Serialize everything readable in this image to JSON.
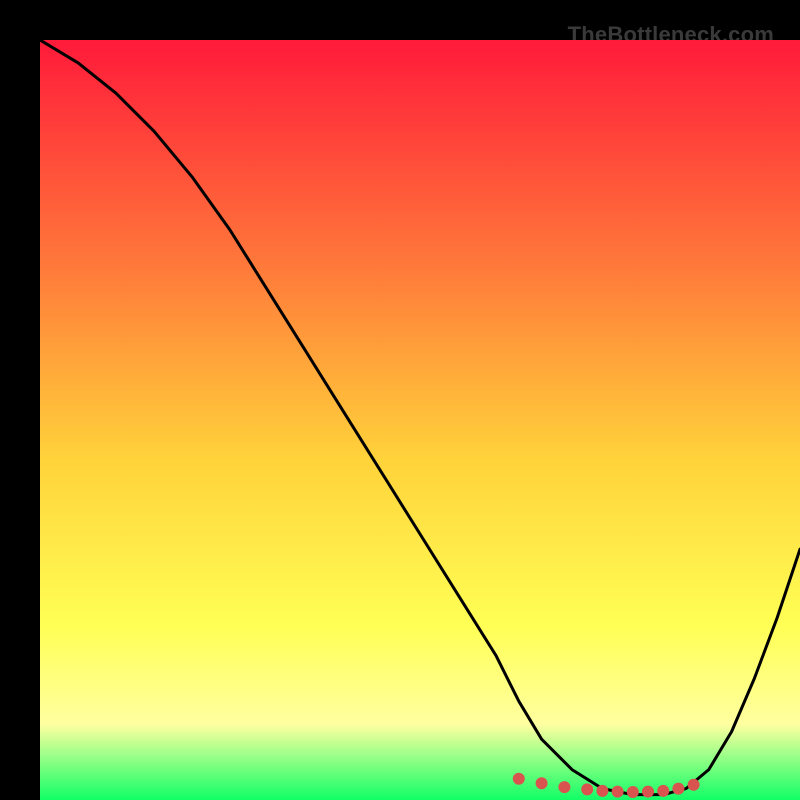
{
  "watermark": "TheBottleneck.com",
  "colors": {
    "bg": "#000000",
    "gradient_top": "#ff1a3a",
    "gradient_mid1": "#ff7a3a",
    "gradient_mid2": "#ffd23a",
    "gradient_mid3": "#ffff55",
    "gradient_mid4": "#ffffa0",
    "gradient_bottom": "#10ff66",
    "curve": "#000000",
    "marker": "#d9544f"
  },
  "chart_data": {
    "type": "line",
    "title": "",
    "xlabel": "",
    "ylabel": "",
    "xlim": [
      0,
      100
    ],
    "ylim": [
      0,
      100
    ],
    "grid": false,
    "legend": false,
    "series": [
      {
        "name": "bottleneck-curve",
        "x": [
          0,
          5,
          10,
          15,
          20,
          25,
          30,
          35,
          40,
          45,
          50,
          55,
          60,
          63,
          66,
          70,
          74,
          78,
          82,
          85,
          88,
          91,
          94,
          97,
          100
        ],
        "y": [
          100,
          97,
          93,
          88,
          82,
          75,
          67,
          59,
          51,
          43,
          35,
          27,
          19,
          13,
          8,
          4,
          1.5,
          0.7,
          0.7,
          1.5,
          4,
          9,
          16,
          24,
          33
        ]
      }
    ],
    "annotations": [
      {
        "name": "minimum-region-markers",
        "x": [
          63,
          66,
          69,
          72,
          74,
          76,
          78,
          80,
          82,
          84,
          86
        ],
        "y": [
          2.8,
          2.2,
          1.7,
          1.4,
          1.2,
          1.1,
          1.05,
          1.1,
          1.2,
          1.5,
          2.0
        ]
      }
    ]
  }
}
